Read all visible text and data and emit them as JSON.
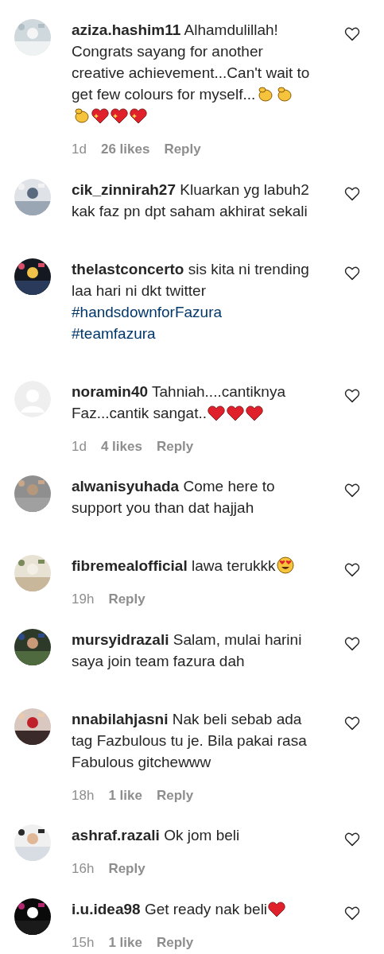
{
  "comments": [
    {
      "avatar": {
        "kind": "picture"
      },
      "username": "aziza.hashim11",
      "body": [
        {
          "kind": "text",
          "text": "Alhamdulillah! Congrats sayang for another creative achievement...Can't wait to get few colours for myself..."
        },
        {
          "kind": "clap"
        },
        {
          "kind": "clap"
        },
        {
          "kind": "clap"
        },
        {
          "kind": "sparkling-heart"
        },
        {
          "kind": "sparkling-heart"
        },
        {
          "kind": "sparkling-heart"
        }
      ],
      "meta": {
        "time": "1d",
        "likes": "26 likes",
        "reply": "Reply"
      }
    },
    {
      "avatar": {
        "kind": "picture"
      },
      "username": "cik_zinnirah27",
      "body": [
        {
          "kind": "text",
          "text": "Kluarkan yg labuh2 kak faz pn dpt saham akhirat sekali"
        }
      ]
    },
    {
      "avatar": {
        "kind": "picture"
      },
      "username": "thelastconcerto",
      "body": [
        {
          "kind": "text",
          "text": "sis kita ni trending laa hari ni dkt twitter"
        },
        {
          "kind": "tag",
          "text": "#handsdownforFazura"
        },
        {
          "kind": "tag",
          "text": "#teamfazura"
        }
      ]
    },
    {
      "avatar": {
        "kind": "default"
      },
      "username": "noramin40",
      "body": [
        {
          "kind": "text",
          "text": "Tahniah....cantiknya Faz...cantik sangat.."
        },
        {
          "kind": "heart"
        },
        {
          "kind": "heart"
        },
        {
          "kind": "heart"
        }
      ],
      "meta": {
        "time": "1d",
        "likes": "4 likes",
        "reply": "Reply"
      }
    },
    {
      "avatar": {
        "kind": "picture"
      },
      "username": "alwanisyuhada",
      "body": [
        {
          "kind": "text",
          "text": "Come here to support you than dat hajjah"
        }
      ]
    },
    {
      "avatar": {
        "kind": "picture"
      },
      "username": "fibremealofficial",
      "body": [
        {
          "kind": "text",
          "text": "lawa terukkk"
        },
        {
          "kind": "heart-eyes"
        }
      ],
      "meta": {
        "time": "19h",
        "reply": "Reply"
      }
    },
    {
      "avatar": {
        "kind": "picture"
      },
      "username": "mursyidrazali",
      "body": [
        {
          "kind": "text",
          "text": "Salam, mulai harini saya join team fazura dah"
        }
      ]
    },
    {
      "avatar": {
        "kind": "picture"
      },
      "username": "nnabilahjasni",
      "body": [
        {
          "kind": "text",
          "text": "Nak beli sebab ada tag Fazbulous tu je. Bila pakai rasa Fabulous gitchewww"
        }
      ],
      "meta": {
        "time": "18h",
        "likes": "1 like",
        "reply": "Reply"
      }
    },
    {
      "avatar": {
        "kind": "picture"
      },
      "username": "ashraf.razali",
      "body": [
        {
          "kind": "text",
          "text": "Ok jom beli"
        }
      ],
      "meta": {
        "time": "16h",
        "reply": "Reply"
      }
    },
    {
      "avatar": {
        "kind": "picture"
      },
      "username": "i.u.idea98",
      "body": [
        {
          "kind": "text",
          "text": "Get ready nak beli"
        },
        {
          "kind": "heart"
        }
      ],
      "meta": {
        "time": "15h",
        "likes": "1 like",
        "reply": "Reply"
      }
    }
  ]
}
